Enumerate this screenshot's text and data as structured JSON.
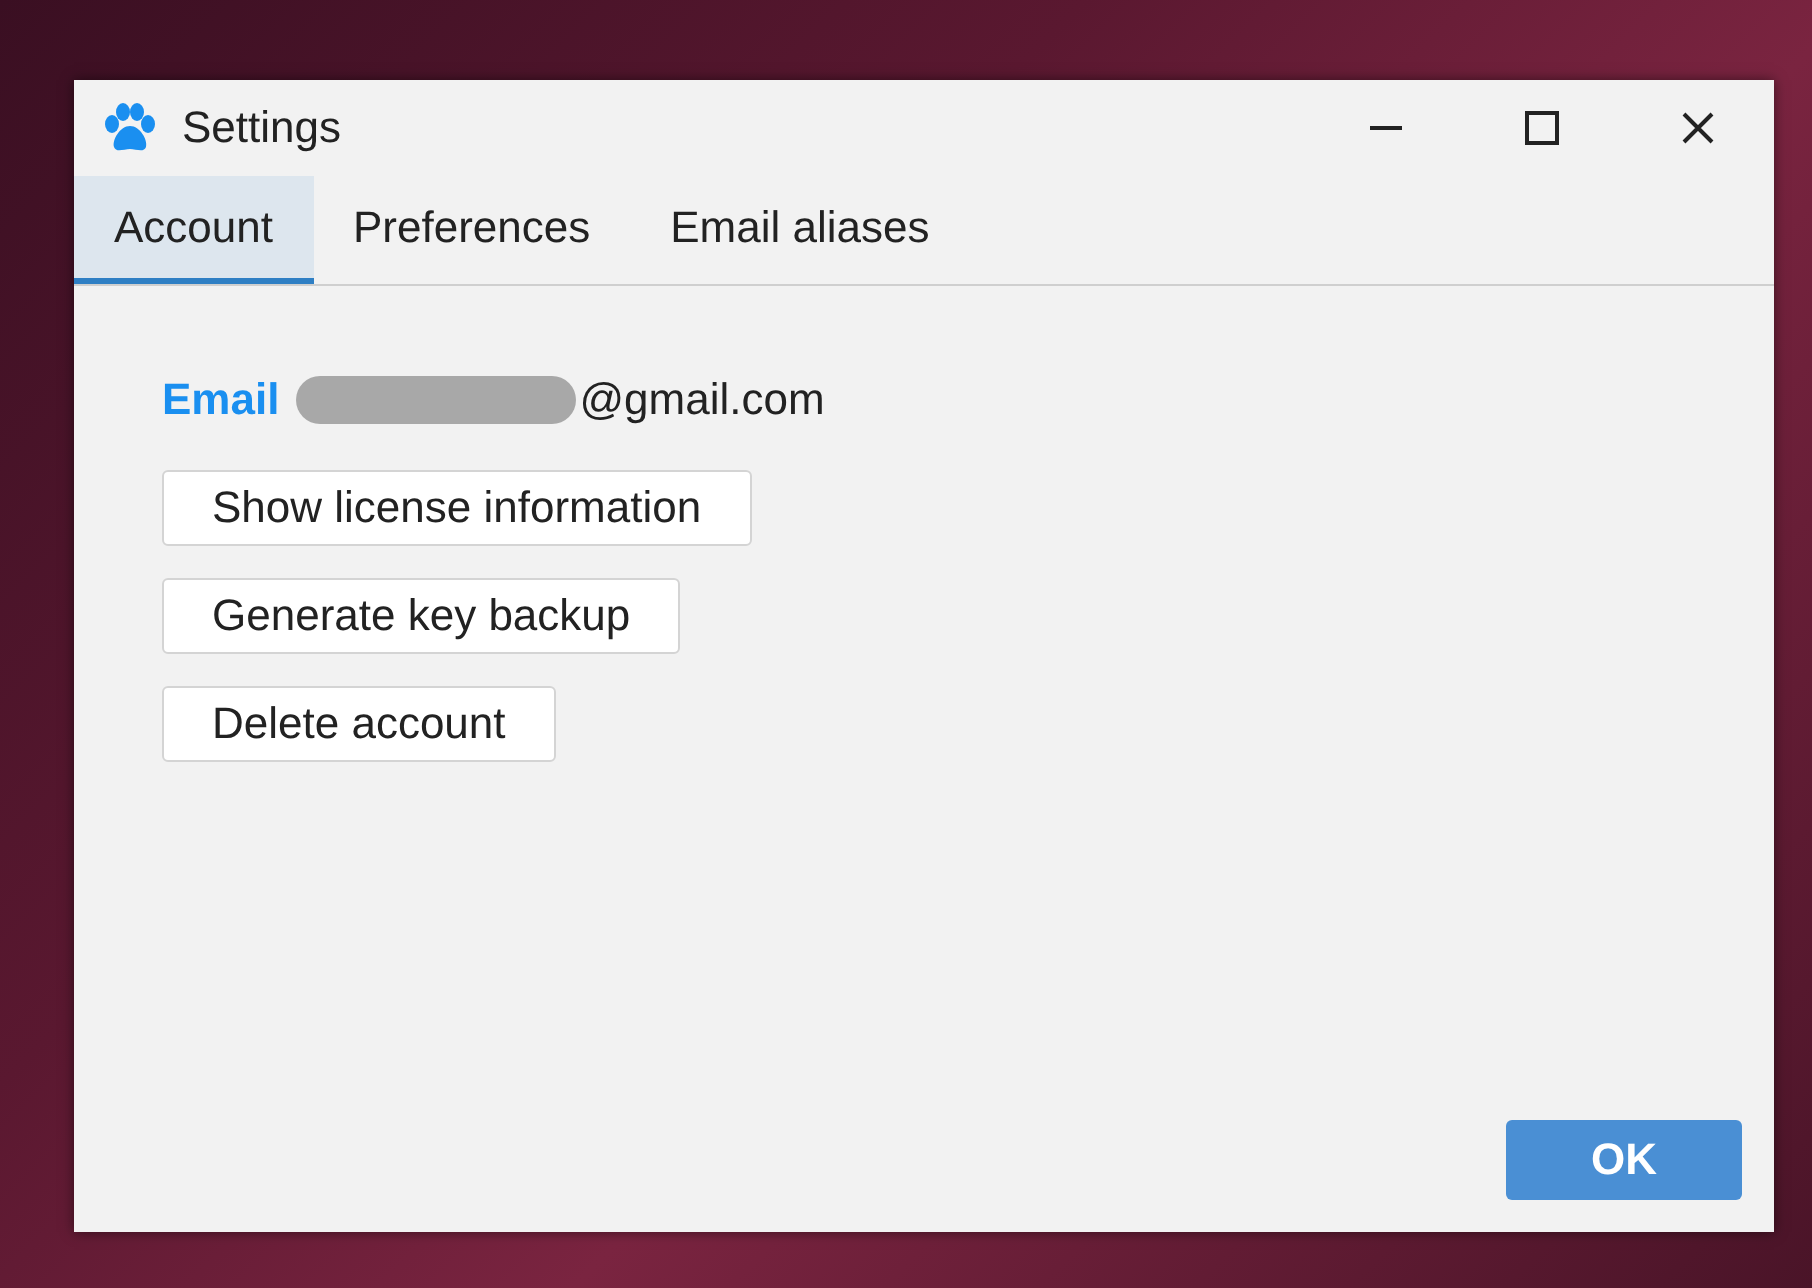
{
  "window": {
    "title": "Settings"
  },
  "tabs": [
    {
      "label": "Account",
      "selected": true
    },
    {
      "label": "Preferences",
      "selected": false
    },
    {
      "label": "Email aliases",
      "selected": false
    }
  ],
  "account": {
    "email_label": "Email",
    "email_value": "@gmail.com",
    "buttons": [
      "Show license information",
      "Generate key backup",
      "Delete account"
    ]
  },
  "footer": {
    "ok": "OK"
  }
}
